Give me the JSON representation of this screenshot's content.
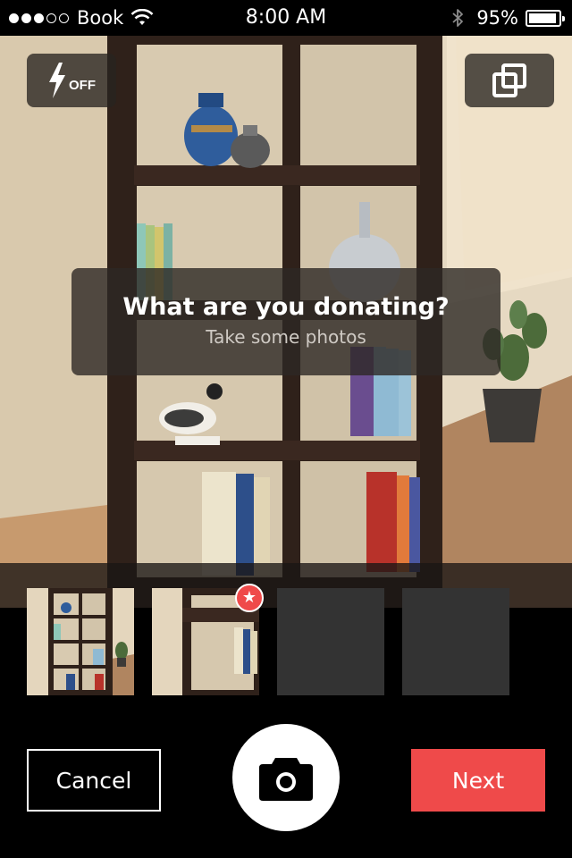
{
  "status_bar": {
    "signal_bars_filled": 3,
    "signal_bars_total": 5,
    "carrier": "Book",
    "wifi_icon": "wifi-icon",
    "time": "8:00 AM",
    "bluetooth_icon": "bluetooth-icon",
    "battery_percent_label": "95%",
    "battery_level": 0.95
  },
  "camera": {
    "flash": {
      "icon": "lightning-bolt-icon",
      "label": "OFF"
    },
    "switch_camera": {
      "icon": "switch-camera-icon"
    },
    "prompt": {
      "title": "What are you donating?",
      "subtitle": "Take some photos"
    }
  },
  "thumbnails": [
    {
      "state": "photo",
      "primary": false
    },
    {
      "state": "photo",
      "primary": true,
      "badge_icon": "star-icon",
      "badge_glyph": "★"
    },
    {
      "state": "empty"
    },
    {
      "state": "empty"
    }
  ],
  "controls": {
    "cancel_label": "Cancel",
    "shutter_icon": "camera-icon",
    "next_label": "Next"
  },
  "colors": {
    "accent": "#ef4a4a",
    "background": "#000000",
    "overlay": "#2d2824"
  }
}
